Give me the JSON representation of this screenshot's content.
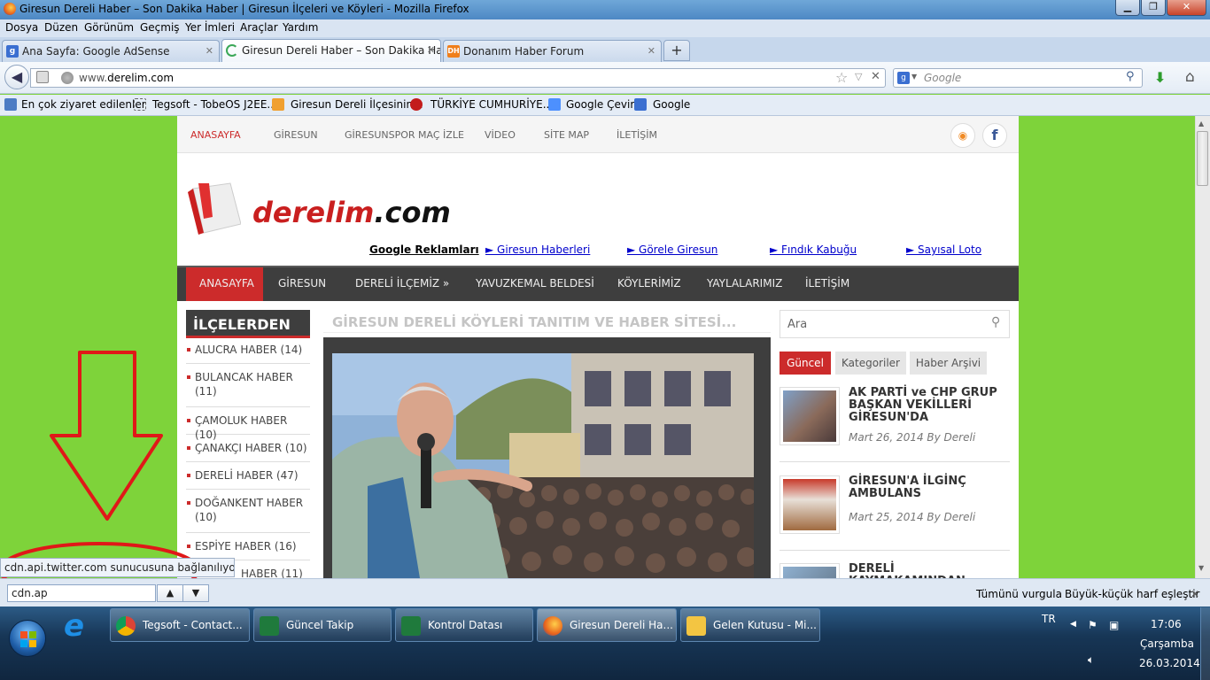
{
  "window": {
    "title": "Giresun Dereli Haber – Son Dakika Haber | Giresun İlçeleri ve Köyleri - Mozilla Firefox",
    "minimize": "▁",
    "maximize": "❐",
    "close": "✕"
  },
  "menu": [
    "Dosya",
    "Düzen",
    "Görünüm",
    "Geçmiş",
    "Yer İmleri",
    "Araçlar",
    "Yardım"
  ],
  "tabs": [
    {
      "label": "Ana Sayfa: Google AdSense",
      "icon": "g"
    },
    {
      "label": "Giresun Dereli Haber – Son Dakika Ha...",
      "icon": "loading"
    },
    {
      "label": "Donanım Haber Forum",
      "icon": "DH"
    }
  ],
  "newtab": "+",
  "nav": {
    "url_host": "www.",
    "url_domain": "derelim.com",
    "search_placeholder": "Google"
  },
  "bookmarks": [
    "En çok ziyaret edilenler",
    "Tegsoft - TobeOS J2EE...",
    "Giresun Dereli İlçesinin...",
    "TÜRKİYE CUMHURİYE...",
    "Google Çeviri",
    "Google"
  ],
  "site": {
    "topnav": [
      "ANASAYFA",
      "GİRESUN",
      "GİRESUNSPOR MAÇ İZLE",
      "VİDEO",
      "SİTE MAP",
      "İLETİŞİM"
    ],
    "logo_red": "derelim",
    "logo_black": ".com",
    "ad_label": "Google Reklamları",
    "ad_links": [
      "► Giresun Haberleri",
      "► Görele Giresun",
      "► Fındık Kabuğu",
      "► Sayısal Loto"
    ],
    "mainnav": [
      "ANASAYFA",
      "GİRESUN",
      "DERELİ İLÇEMİZ »",
      "YAVUZKEMAL BELDESİ",
      "KÖYLERİMİZ",
      "YAYLALARIMIZ",
      "İLETİŞİM"
    ],
    "sidebar_title": "İLÇELERDEN",
    "categories": [
      "ALUCRA HABER (14)",
      "BULANCAK HABER (11)",
      "ÇAMOLUK HABER (10)",
      "ÇANAKÇI HABER (10)",
      "DERELİ HABER (47)",
      "DOĞANKENT HABER (10)",
      "ESPİYE HABER (16)",
      "HABER (11)"
    ],
    "center_heading": "GİRESUN DERELİ KÖYLERİ TANITIM VE HABER SİTESİ...",
    "search_placeholder": "Ara",
    "right_tabs": [
      "Güncel",
      "Kategoriler",
      "Haber Arşivi"
    ],
    "posts": [
      {
        "title": "AK PARTİ ve CHP GRUP BAŞKAN VEKİLLERİ GİRESUN'DA",
        "meta": "Mart 26, 2014 By Dereli"
      },
      {
        "title": "GİRESUN'A İLGİNÇ AMBULANS",
        "meta": "Mart 25, 2014 By Dereli"
      },
      {
        "title": "DERELİ KAYMAKAMINDAN",
        "meta": ""
      }
    ]
  },
  "status_text": "cdn.api.twitter.com sunucusuna bağlanılıyor...",
  "findbar": {
    "query": "cdn.ap",
    "highlight_all": "Tümünü vurgula",
    "match_case": "Büyük-küçük harf eşleştir"
  },
  "taskbar": {
    "items": [
      "Tegsoft - Contact...",
      "Güncel Takip",
      "Kontrol Datası",
      "Giresun Dereli Ha...",
      "Gelen Kutusu - Mi..."
    ],
    "lang": "TR",
    "time": "17:06",
    "day": "Çarşamba",
    "date": "26.03.2014"
  },
  "colors": {
    "accent_red": "#cc2b2b",
    "page_bg": "#7ed33a",
    "annotation_red": "#e01818"
  }
}
